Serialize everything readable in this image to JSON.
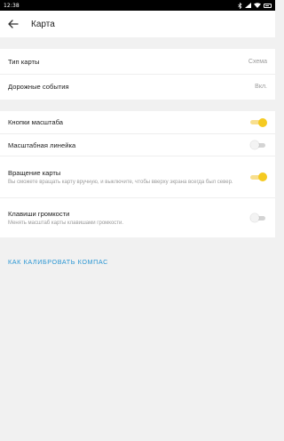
{
  "status_bar": {
    "time": "12:38",
    "icons": [
      "bluetooth-icon",
      "signal-icon",
      "wifi-icon",
      "battery-icon"
    ]
  },
  "app_bar": {
    "title": "Карта",
    "back_icon": "arrow-left-icon"
  },
  "map_group": {
    "map_type": {
      "label": "Тип карты",
      "value": "Схема"
    },
    "road_events": {
      "label": "Дорожные события",
      "value": "Вкл."
    }
  },
  "controls_group": {
    "zoom_buttons": {
      "label": "Кнопки масштаба",
      "enabled": true
    },
    "scale_bar": {
      "label": "Масштабная линейка",
      "enabled": false
    },
    "map_rotation": {
      "label": "Вращение карты",
      "description": "Вы сможете вращать карту вручную, и выключите, чтобы вверху экрана всегда был север.",
      "enabled": true
    },
    "volume_keys": {
      "label": "Клавиши громкости",
      "description": "Менять масштаб карты клавишами громкости.",
      "enabled": false
    }
  },
  "calibrate_link": "КАК КАЛИБРОВАТЬ КОМПАС",
  "colors": {
    "accent_toggle": "#f5ca21",
    "link": "#2a96d3",
    "background": "#f1f1f1"
  }
}
